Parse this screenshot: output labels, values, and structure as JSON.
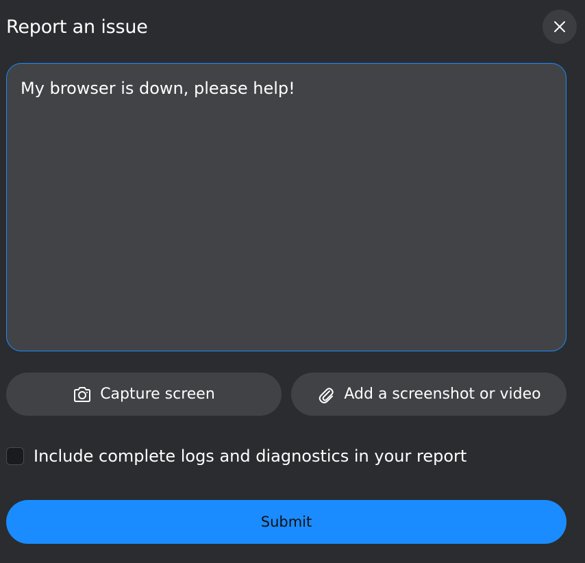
{
  "dialog": {
    "title": "Report an issue",
    "close_icon": "close-icon"
  },
  "report": {
    "text": "My browser is down, please help!"
  },
  "actions": {
    "capture_label": "Capture screen",
    "capture_icon": "camera-icon",
    "attach_label": "Add a screenshot or video",
    "attach_icon": "paperclip-icon"
  },
  "logs_option": {
    "label": "Include complete logs and diagnostics in your report",
    "checked": false
  },
  "submit": {
    "label": "Submit"
  },
  "colors": {
    "background": "#2b2c30",
    "accent": "#1a8cff",
    "field": "#424346",
    "pill": "#414245"
  }
}
